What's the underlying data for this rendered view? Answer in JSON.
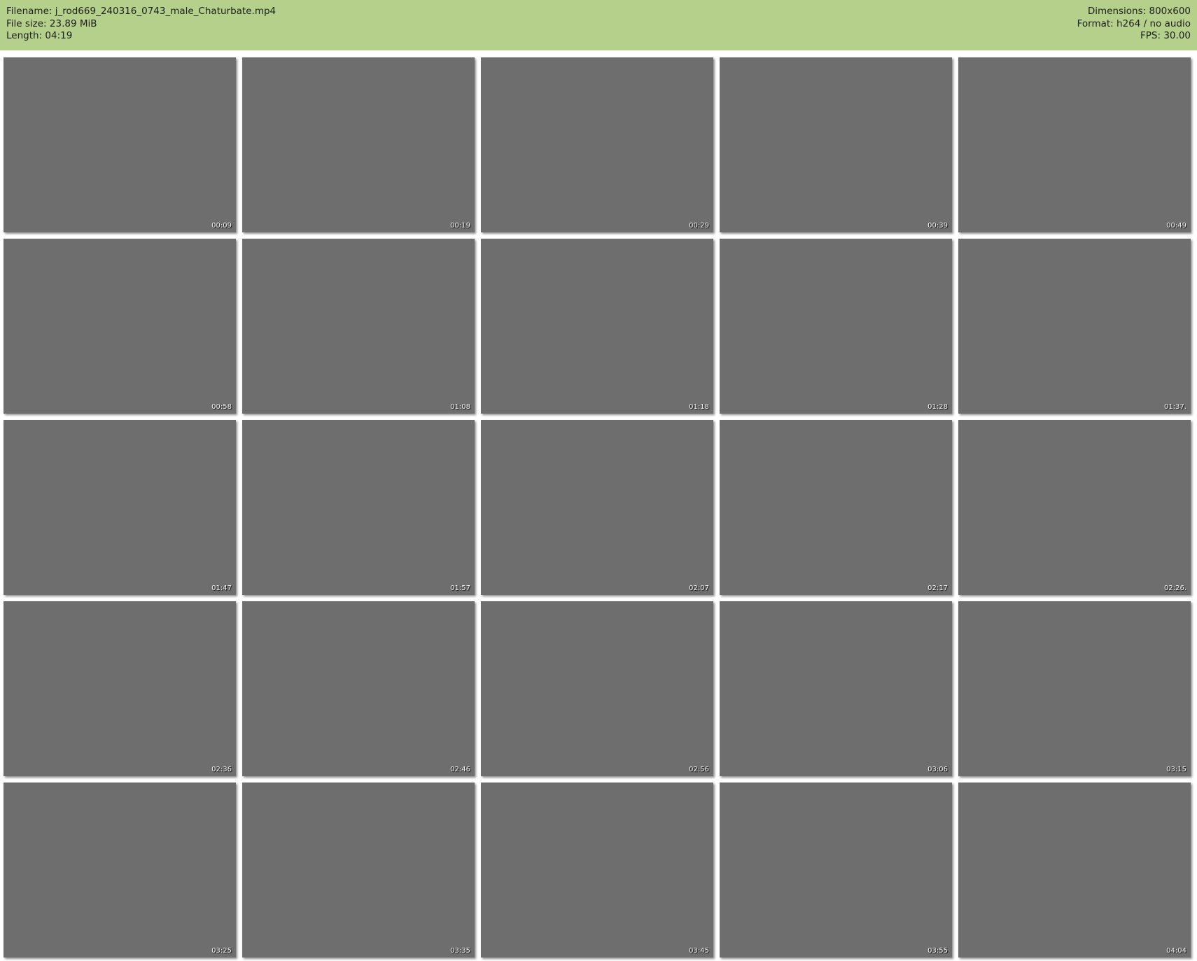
{
  "header": {
    "filename": "Filename: j_rod669_240316_0743_male_Chaturbate.mp4",
    "filesize": "File size: 23.89 MiB",
    "length": "Length: 04:19",
    "dimensions": "Dimensions: 800x600",
    "format": "Format: h264 / no audio",
    "fps": "FPS: 30.00"
  },
  "frames": [
    "00:09",
    "00:19",
    "00:29",
    "00:39",
    "00:49",
    "00:58",
    "01:08",
    "01:18",
    "01:28",
    "01:37.",
    "01:47",
    "01:57",
    "02:07",
    "02:17",
    "02:26.",
    "02:36",
    "02:46",
    "02:56",
    "03:06",
    "03:15",
    "03:25",
    "03:35",
    "03:45",
    "03:55",
    "04:04"
  ]
}
